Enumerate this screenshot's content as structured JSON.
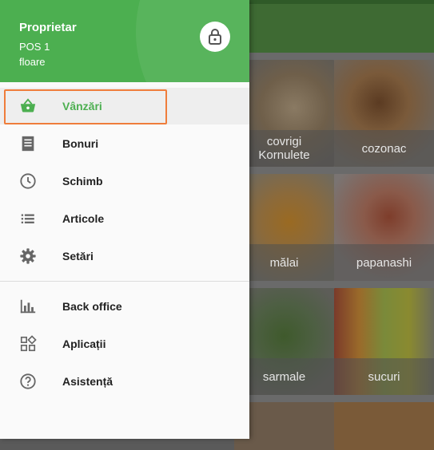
{
  "header": {
    "owner": "Proprietar",
    "pos": "POS 1",
    "store": "floare"
  },
  "menu_primary": [
    {
      "label": "Vânzări",
      "icon": "basket-icon",
      "active": true
    },
    {
      "label": "Bonuri",
      "icon": "receipt-icon"
    },
    {
      "label": "Schimb",
      "icon": "clock-icon"
    },
    {
      "label": "Articole",
      "icon": "list-icon"
    },
    {
      "label": "Setări",
      "icon": "gear-icon"
    }
  ],
  "menu_secondary": [
    {
      "label": "Back office",
      "icon": "bar-chart-icon"
    },
    {
      "label": "Aplicații",
      "icon": "apps-icon"
    },
    {
      "label": "Asistență",
      "icon": "help-icon"
    }
  ],
  "products": [
    {
      "name": "covrigi\nKornulete"
    },
    {
      "name": "cozonac"
    },
    {
      "name": "mălai"
    },
    {
      "name": "papanashi"
    },
    {
      "name": "sarmale"
    },
    {
      "name": "sucuri"
    }
  ],
  "colors": {
    "brand": "#4caf50",
    "highlight": "#ef7d3b"
  }
}
